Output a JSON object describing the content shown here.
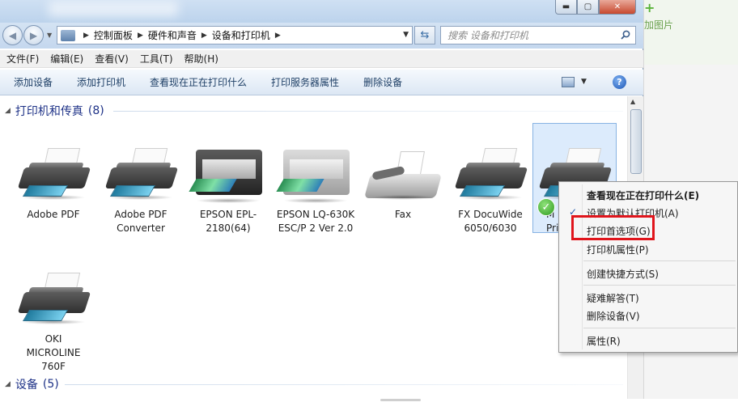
{
  "background": {
    "add_picture_text": "加图片"
  },
  "window": {
    "controls": {
      "minimize": "▬",
      "maximize": "▢",
      "close": "✕"
    }
  },
  "address_bar": {
    "breadcrumbs": [
      "控制面板",
      "硬件和声音",
      "设备和打印机"
    ],
    "search_placeholder": "搜索 设备和打印机"
  },
  "menubar": {
    "items": [
      "文件(F)",
      "编辑(E)",
      "查看(V)",
      "工具(T)",
      "帮助(H)"
    ]
  },
  "command_bar": {
    "items": [
      "添加设备",
      "添加打印机",
      "查看现在正在打印什么",
      "打印服务器属性",
      "删除设备"
    ],
    "help_label": "?"
  },
  "groups": {
    "printers": {
      "title": "打印机和传真",
      "count": "(8)"
    },
    "devices": {
      "title": "设备",
      "count": "(5)"
    }
  },
  "devices": [
    {
      "name": "Adobe PDF",
      "kind": "printer"
    },
    {
      "name": "Adobe PDF Converter",
      "kind": "printer"
    },
    {
      "name": "EPSON EPL-2180(64)",
      "kind": "epson-dark"
    },
    {
      "name": "EPSON LQ-630K ESC/P 2 Ver 2.0",
      "kind": "epson-gray"
    },
    {
      "name": "Fax",
      "kind": "fax"
    },
    {
      "name": "FX DocuWide 6050/6030",
      "kind": "printer"
    },
    {
      "name": "M\nPri",
      "kind": "printer",
      "selected": true,
      "default": true
    },
    {
      "name": "OKI MICROLINE 760F",
      "kind": "printer"
    }
  ],
  "context_menu": {
    "items": [
      {
        "label": "查看现在正在打印什么(E)",
        "bold": true
      },
      {
        "label": "设置为默认打印机(A)",
        "checked": true
      },
      {
        "label": "打印首选项(G)",
        "highlighted": true
      },
      {
        "label": "打印机属性(P)"
      },
      {
        "label": "创建快捷方式(S)"
      },
      {
        "label": "疑难解答(T)"
      },
      {
        "label": "删除设备(V)"
      },
      {
        "label": "属性(R)"
      }
    ]
  },
  "colors": {
    "highlight_box": "#e0151c",
    "group_title": "#1e3287",
    "command_text": "#1e3f66"
  }
}
